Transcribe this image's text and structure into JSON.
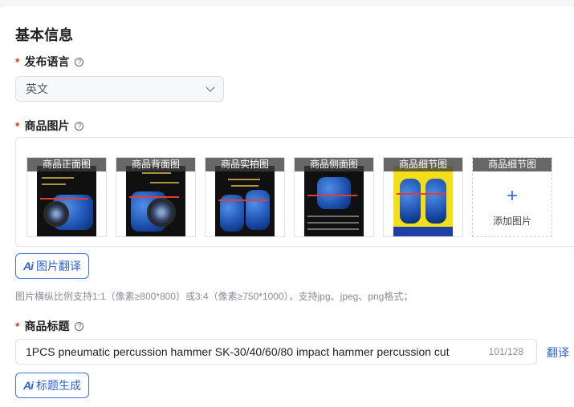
{
  "section": {
    "title": "基本信息"
  },
  "language": {
    "required_mark": "*",
    "label": "发布语言",
    "help_icon": "?",
    "selected": "英文"
  },
  "images": {
    "required_mark": "*",
    "label": "商品图片",
    "help_icon": "?",
    "thumbnails": [
      {
        "caption": "商品正面图"
      },
      {
        "caption": "商品背面图"
      },
      {
        "caption": "商品实拍图"
      },
      {
        "caption": "商品侧面图"
      },
      {
        "caption": "商品细节图"
      }
    ],
    "add_slot": {
      "caption": "商品细节图",
      "plus": "+",
      "label": "添加图片"
    },
    "translate_button": {
      "icon": "Ai",
      "label": "图片翻译"
    },
    "hint": "图片横纵比例支持1:1（像素≥800*800）或3:4（像素≥750*1000），支持jpg、jpeg、png格式；"
  },
  "product_title": {
    "required_mark": "*",
    "label": "商品标题",
    "help_icon": "?",
    "value": "1PCS pneumatic percussion hammer SK-30/40/60/80 impact hammer percussion cut",
    "counter": "101/128",
    "translate_link": "翻译",
    "generate_button": {
      "icon": "Ai",
      "label": "标题生成"
    }
  },
  "colors": {
    "accent": "#2f63d3",
    "required": "#e5392f"
  }
}
